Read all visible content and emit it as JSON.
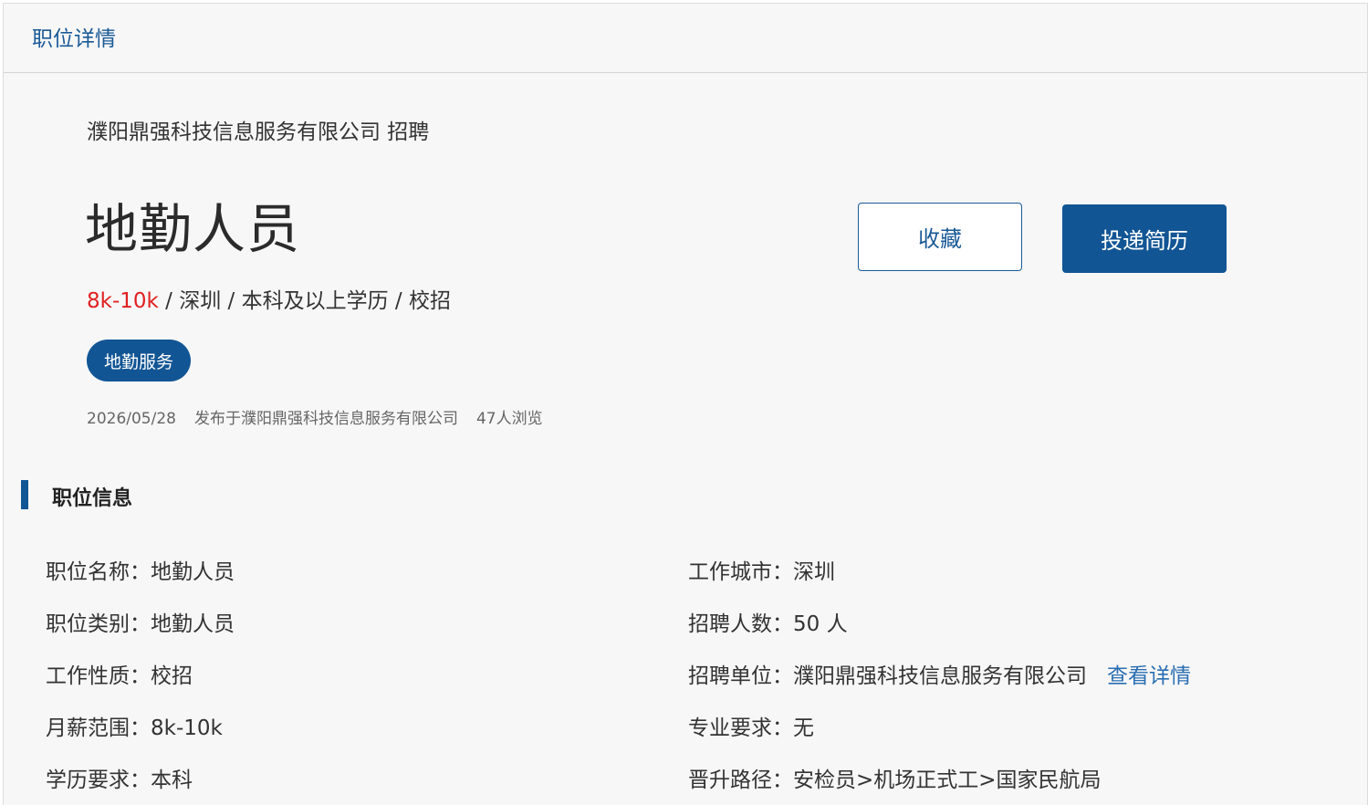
{
  "header": {
    "title": "职位详情"
  },
  "job": {
    "company_recruit": "濮阳鼎强科技信息服务有限公司 招聘",
    "title": "地勤人员",
    "salary": "8k-10k",
    "summary_rest": " / 深圳 / 本科及以上学历 / 校招",
    "tag": "地勤服务",
    "meta": {
      "date": "2026/05/28",
      "publisher": "发布于濮阳鼎强科技信息服务有限公司",
      "views": "47人浏览"
    }
  },
  "actions": {
    "favorite_label": "收藏",
    "apply_label": "投递简历"
  },
  "section": {
    "title": "职位信息"
  },
  "info": {
    "left": [
      {
        "label": "职位名称：",
        "value": "地勤人员"
      },
      {
        "label": "职位类别：",
        "value": "地勤人员"
      },
      {
        "label": "工作性质：",
        "value": "校招"
      },
      {
        "label": "月薪范围：",
        "value": "8k-10k"
      },
      {
        "label": "学历要求：",
        "value": "本科"
      }
    ],
    "right": [
      {
        "label": "工作城市：",
        "value": "深圳"
      },
      {
        "label": "招聘人数：",
        "value": "50 人"
      },
      {
        "label": "招聘单位：",
        "value": "濮阳鼎强科技信息服务有限公司",
        "link": "查看详情"
      },
      {
        "label": "专业要求：",
        "value": "无"
      },
      {
        "label": "晋升路径：",
        "value": "安检员>机场正式工>国家民航局"
      }
    ]
  }
}
